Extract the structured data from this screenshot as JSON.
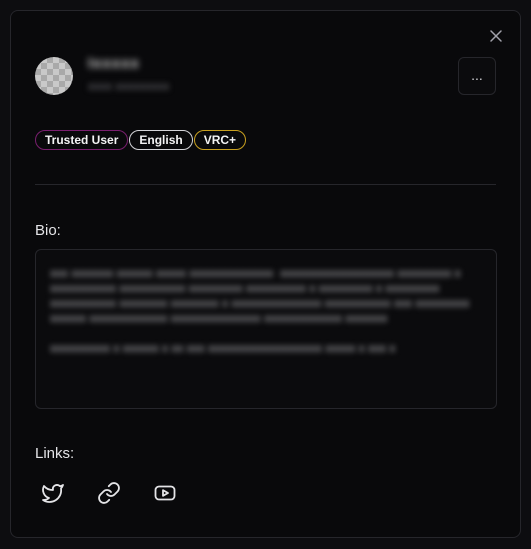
{
  "modal": {
    "close_icon": "close-icon",
    "more_button_label": "...",
    "profile": {
      "name": "Ixxxxx",
      "subname": "xxxx xxxxxxxxx"
    },
    "badges": [
      {
        "label": "Trusted User",
        "color": "#7a1f6f"
      },
      {
        "label": "English",
        "color": "#d4d4d8"
      },
      {
        "label": "VRC+",
        "color": "#c8a020"
      }
    ],
    "bio": {
      "label": "Bio:",
      "text": "xxx xxxxxxx xxxxxx xxxxx xxxxxxxxxxxxxx  xxxxxxxxxxxxxxxxxxx xxxxxxxxx x xxxxxxxxxxx xxxxxxxxxxx xxxxxxxxx xxxxxxxxxx x xxxxxxxxx x xxxxxxxxx xxxxxxxxxxx xxxxxxxx xxxxxxxx x xxxxxxxxxxxxxxx xxxxxxxxxxx xxx xxxxxxxxx xxxxxx xxxxxxxxxxxxx xxxxxxxxxxxxxxx xxxxxxxxxxxxx xxxxxxx\n\nxxxxxxxxxx x xxxxxx x xx xxx xxxxxxxxxxxxxxxxxxx xxxxx x xxx x"
    },
    "links": {
      "label": "Links:",
      "icons": [
        "twitter-icon",
        "link-icon",
        "youtube-icon"
      ]
    }
  }
}
